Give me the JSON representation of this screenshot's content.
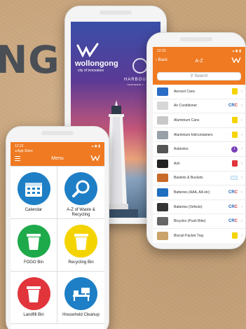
{
  "brand_text": "NG",
  "colors": {
    "accent": "#ef7a22",
    "blue": "#1e7fc6",
    "green": "#1eaa4b",
    "yellow": "#f4d400",
    "red": "#e2343b"
  },
  "splash": {
    "logo_name": "wollongong",
    "logo_tagline": "city of innovation",
    "harbour": "HARBOUR",
    "harbour_sub": "YOUR WASTE, Y..."
  },
  "az": {
    "status_time": "12:23",
    "back_label": "Back",
    "title": "A-Z",
    "search_placeholder": "Search",
    "items": [
      {
        "label": "Aerosol Cans",
        "icon": "bin-yellow"
      },
      {
        "label": "Air Conditioner",
        "icon": "crc"
      },
      {
        "label": "Aluminium Cans",
        "icon": "bin-yellow"
      },
      {
        "label": "Aluminium foil/containers",
        "icon": "bin-yellow"
      },
      {
        "label": "Asbestos",
        "icon": "info"
      },
      {
        "label": "Ash",
        "icon": "bin-red"
      },
      {
        "label": "Baskets & Buckets",
        "icon": "gauge"
      },
      {
        "label": "Batteries (AAA, AA etc)",
        "icon": "crc"
      },
      {
        "label": "Batteries (Vehicle)",
        "icon": "crc"
      },
      {
        "label": "Bicycles (Push Bike)",
        "icon": "crc"
      },
      {
        "label": "Biscuit Packet Tray",
        "icon": "bin-yellow"
      }
    ],
    "crc_left": "CR",
    "crc_right": "C",
    "info_mark": "i"
  },
  "menu": {
    "status_time": "12:22",
    "status_sub": "◂ App Store",
    "title": "Menu",
    "tiles": [
      {
        "label": "Calendar",
        "icon": "calendar-icon"
      },
      {
        "label": "A-Z of Waste & Recycling",
        "icon": "search-icon"
      },
      {
        "label": "FOGO Bin",
        "icon": "green-bin-icon"
      },
      {
        "label": "Recycling Bin",
        "icon": "yellow-bin-icon"
      },
      {
        "label": "Landfill Bin",
        "icon": "red-bin-icon"
      },
      {
        "label": "Household Cleanup",
        "icon": "furniture-icon"
      }
    ]
  }
}
